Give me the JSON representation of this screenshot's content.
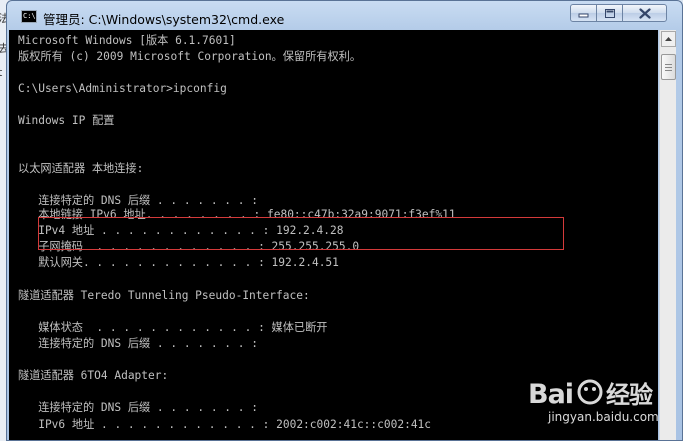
{
  "window": {
    "title": "管理员: C:\\Windows\\system32\\cmd.exe",
    "app_icon_text": "C:\\"
  },
  "background_fragments": [
    "法",
    "去",
    "t"
  ],
  "console": {
    "lines": [
      "Microsoft Windows [版本 6.1.7601]",
      "版权所有 (c) 2009 Microsoft Corporation。保留所有权利。",
      "",
      "C:\\Users\\Administrator>ipconfig",
      "",
      "Windows IP 配置",
      "",
      "",
      "以太网适配器 本地连接:",
      "",
      "   连接特定的 DNS 后缀 . . . . . . . :",
      "   本地链接 IPv6 地址. . . . . . . . : fe80::c47b:32a9:9071:f3ef%11",
      "   IPv4 地址 . . . . . . . . . . . . : 192.2.4.28",
      "   子网掩码  . . . . . . . . . . . . : 255.255.255.0",
      "   默认网关. . . . . . . . . . . . . : 192.2.4.51",
      "",
      "隧道适配器 Teredo Tunneling Pseudo-Interface:",
      "",
      "   媒体状态  . . . . . . . . . . . . : 媒体已断开",
      "   连接特定的 DNS 后缀 . . . . . . . :",
      "",
      "隧道适配器 6TO4 Adapter:",
      "",
      "   连接特定的 DNS 后缀 . . . . . . . :",
      "   IPv6 地址 . . . . . . . . . . . . : 2002:c002:41c::c002:41c"
    ]
  },
  "watermark": {
    "logo": "Bai经验",
    "url": "jingyan.baidu.com"
  },
  "colors": {
    "console_bg": "#000000",
    "console_fg": "#c0c0c0",
    "highlight_border": "#d43a3a"
  },
  "icons": [
    "cmd-app-icon",
    "minimize-icon",
    "maximize-icon",
    "close-icon",
    "scroll-up-icon"
  ]
}
